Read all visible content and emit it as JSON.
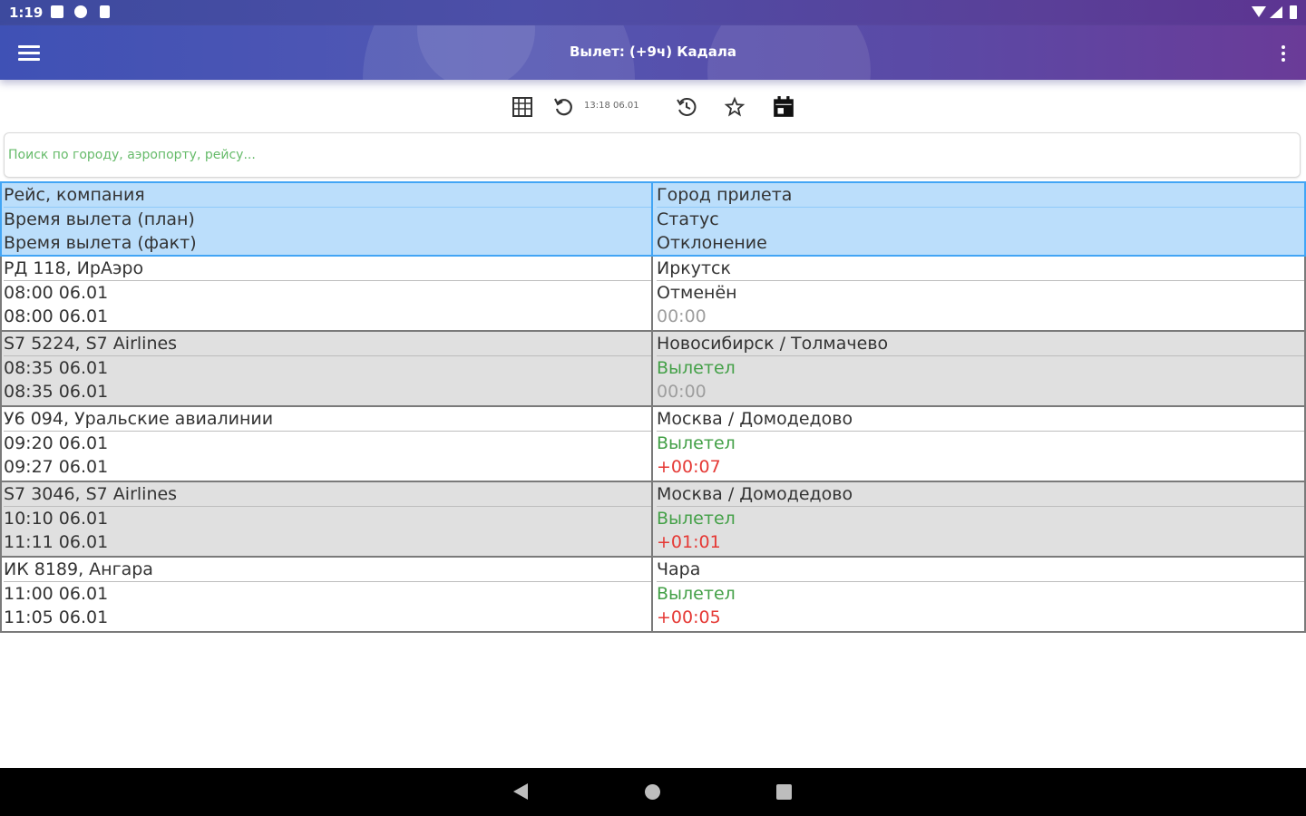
{
  "status_bar": {
    "time": "1:19"
  },
  "app_bar": {
    "title": "Вылет: (+9ч) Кадала"
  },
  "toolbar": {
    "timestamp": "13:18 06.01"
  },
  "search": {
    "placeholder": "Поиск по городу, аэропорту, рейсу...",
    "value": ""
  },
  "header": {
    "left": [
      "Рейс, компания",
      "Время вылета (план)",
      "Время вылета (факт)"
    ],
    "right": [
      "Город прилета",
      "Статус",
      "Отклонение"
    ]
  },
  "flights": [
    {
      "flight": "РД 118, ИрАэро",
      "planned": "08:00 06.01",
      "actual": "08:00 06.01",
      "city": "Иркутск",
      "status": "Отменён",
      "deviation": "00:00"
    },
    {
      "flight": "S7 5224, S7 Airlines",
      "planned": "08:35 06.01",
      "actual": "08:35 06.01",
      "city": "Новосибирск / Толмачево",
      "status": "Вылетел",
      "deviation": "00:00"
    },
    {
      "flight": "У6 094, Уральские авиалинии",
      "planned": "09:20 06.01",
      "actual": "09:27 06.01",
      "city": "Москва / Домодедово",
      "status": "Вылетел",
      "deviation": "+00:07"
    },
    {
      "flight": "S7 3046, S7 Airlines",
      "planned": "10:10 06.01",
      "actual": "11:11 06.01",
      "city": "Москва / Домодедово",
      "status": "Вылетел",
      "deviation": "+01:01"
    },
    {
      "flight": "ИК 8189, Ангара",
      "planned": "11:00 06.01",
      "actual": "11:05 06.01",
      "city": "Чара",
      "status": "Вылетел",
      "deviation": "+00:05"
    }
  ],
  "colors": {
    "status_departed": "#43a047",
    "deviation_late": "#e53935",
    "deviation_zero": "#9e9e9e"
  }
}
